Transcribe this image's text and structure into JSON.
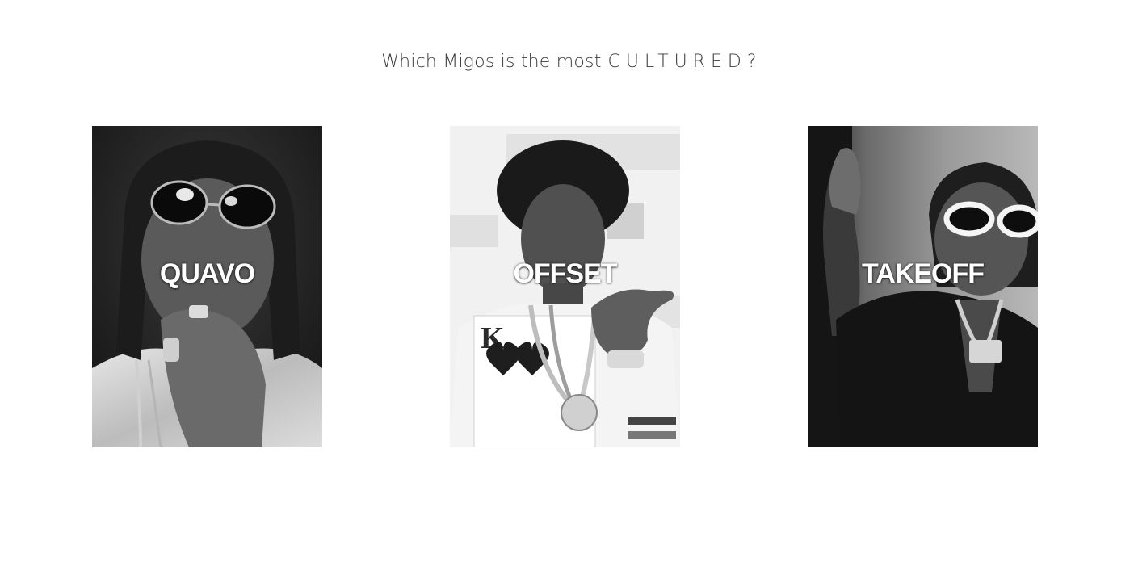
{
  "header": {
    "question": "Which Migos is the most",
    "emphasis": "CULTURED",
    "punctuation": "?"
  },
  "cards": [
    {
      "name": "QUAVO",
      "image": "portrait-quavo"
    },
    {
      "name": "OFFSET",
      "image": "portrait-offset"
    },
    {
      "name": "TAKEOFF",
      "image": "portrait-takeoff"
    }
  ],
  "colors": {
    "background": "#ffffff",
    "headline_text": "#3a3a3a",
    "card_label": "#ffffff"
  }
}
